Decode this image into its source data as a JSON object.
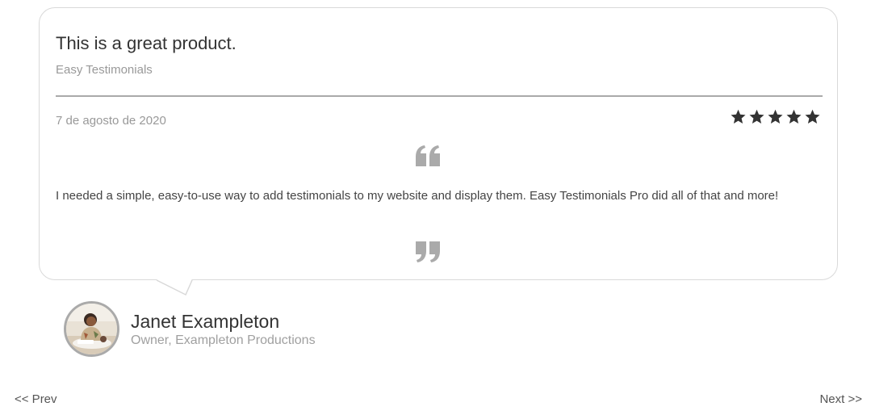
{
  "testimonial": {
    "title": "This is a great product.",
    "subtitle": "Easy Testimonials",
    "date": "7 de agosto de 2020",
    "rating": 5,
    "max_rating": 5,
    "body": "I needed a simple, easy-to-use way to add testimonials to my website and display them. Easy Testimonials Pro did all of that and more!",
    "quote_open_icon": "quote-open-icon",
    "quote_close_icon": "quote-close-icon",
    "star_icon": "star-icon"
  },
  "author": {
    "name": "Janet Exampleton",
    "role": "Owner, Exampleton Productions",
    "avatar_icon": "avatar-photo"
  },
  "navigation": {
    "prev_label": "<< Prev",
    "next_label": "Next >>"
  },
  "colors": {
    "text_dark": "#333333",
    "text_muted": "#999999",
    "border": "#d9d9d9",
    "divider": "#aaaaaa",
    "star": "#333333",
    "quote_icon": "#aaaaaa"
  }
}
